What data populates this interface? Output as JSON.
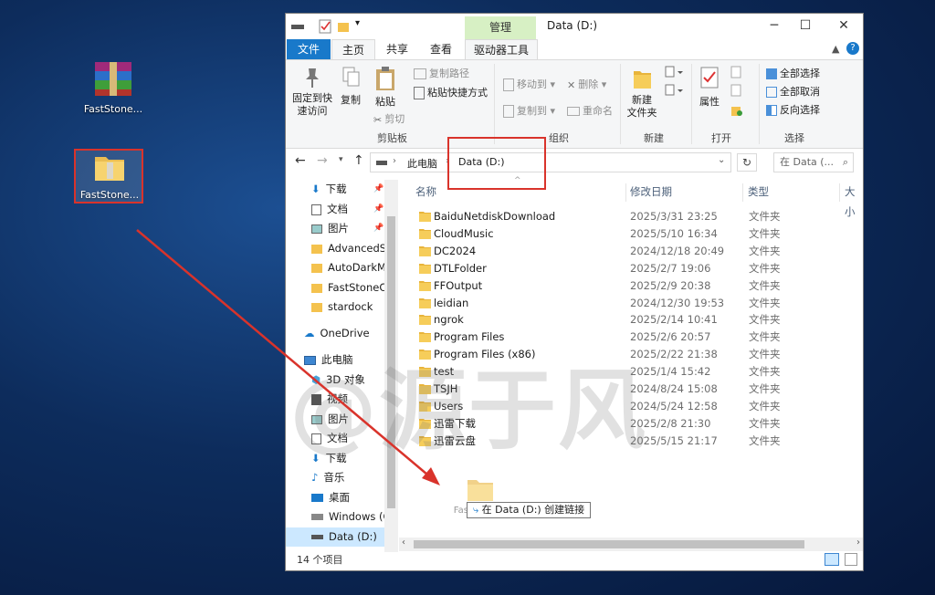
{
  "desktop": {
    "icons": [
      {
        "label": "FastStone..."
      },
      {
        "label": "FastStone..."
      }
    ]
  },
  "window": {
    "title": "Data (D:)",
    "contextual_tab": "管理",
    "tabs": {
      "file": "文件",
      "home": "主页",
      "share": "共享",
      "view": "查看",
      "drive_tools": "驱动器工具"
    },
    "ribbon": {
      "clipboard": {
        "pin_quick_access": "固定到快\n速访问",
        "copy": "复制",
        "paste": "粘贴",
        "copy_path": "复制路径",
        "paste_shortcut": "粘贴快捷方式",
        "cut": "剪切",
        "group": "剪贴板"
      },
      "organize": {
        "move_to": "移动到",
        "copy_to": "复制到",
        "delete": "删除",
        "rename": "重命名",
        "group": "组织"
      },
      "new": {
        "new_folder": "新建\n文件夹",
        "group": "新建"
      },
      "open": {
        "properties": "属性",
        "group": "打开"
      },
      "select": {
        "select_all": "全部选择",
        "select_none": "全部取消",
        "invert": "反向选择",
        "group": "选择"
      }
    },
    "address": {
      "this_pc": "此电脑",
      "current": "Data (D:)",
      "search_placeholder": "在 Data (..."
    },
    "nav_items": {
      "downloads": "下载",
      "documents": "文档",
      "pictures": "图片",
      "advancedsy": "AdvancedSy",
      "autodarkm": "AutoDarkM",
      "faststonec": "FastStoneCa",
      "stardock": "stardock",
      "onedrive": "OneDrive",
      "this_pc": "此电脑",
      "objects3d": "3D 对象",
      "videos": "视频",
      "pictures2": "图片",
      "documents2": "文档",
      "downloads2": "下载",
      "music": "音乐",
      "desktop": "桌面",
      "windows_c": "Windows (C",
      "data_d": "Data (D:)"
    },
    "columns": {
      "name": "名称",
      "modified": "修改日期",
      "type": "类型",
      "size": "大小"
    },
    "files": [
      {
        "name": "BaiduNetdiskDownload",
        "date": "2025/3/31 23:25",
        "type": "文件夹"
      },
      {
        "name": "CloudMusic",
        "date": "2025/5/10 16:34",
        "type": "文件夹"
      },
      {
        "name": "DC2024",
        "date": "2024/12/18 20:49",
        "type": "文件夹"
      },
      {
        "name": "DTLFolder",
        "date": "2025/2/7 19:06",
        "type": "文件夹"
      },
      {
        "name": "FFOutput",
        "date": "2025/2/9 20:38",
        "type": "文件夹"
      },
      {
        "name": "leidian",
        "date": "2024/12/30 19:53",
        "type": "文件夹"
      },
      {
        "name": "ngrok",
        "date": "2025/2/14 10:41",
        "type": "文件夹"
      },
      {
        "name": "Program Files",
        "date": "2025/2/6 20:57",
        "type": "文件夹"
      },
      {
        "name": "Program Files (x86)",
        "date": "2025/2/22 21:38",
        "type": "文件夹"
      },
      {
        "name": "test",
        "date": "2025/1/4 15:42",
        "type": "文件夹"
      },
      {
        "name": "TSJH",
        "date": "2024/8/24 15:08",
        "type": "文件夹"
      },
      {
        "name": "Users",
        "date": "2024/5/24 12:58",
        "type": "文件夹"
      },
      {
        "name": "迅雷下载",
        "date": "2025/2/8 21:30",
        "type": "文件夹"
      },
      {
        "name": "迅雷云盘",
        "date": "2025/5/15 21:17",
        "type": "文件夹"
      }
    ],
    "drag": {
      "tooltip": "在 Data (D:) 创建链接",
      "ghost_label": "FastStone..."
    },
    "status": "14 个项目"
  },
  "watermark": "@源于风",
  "colors": {
    "accent": "#1979ca",
    "annotation": "#d9332b",
    "folder": "#f4c24e",
    "selection": "#cce8ff"
  }
}
